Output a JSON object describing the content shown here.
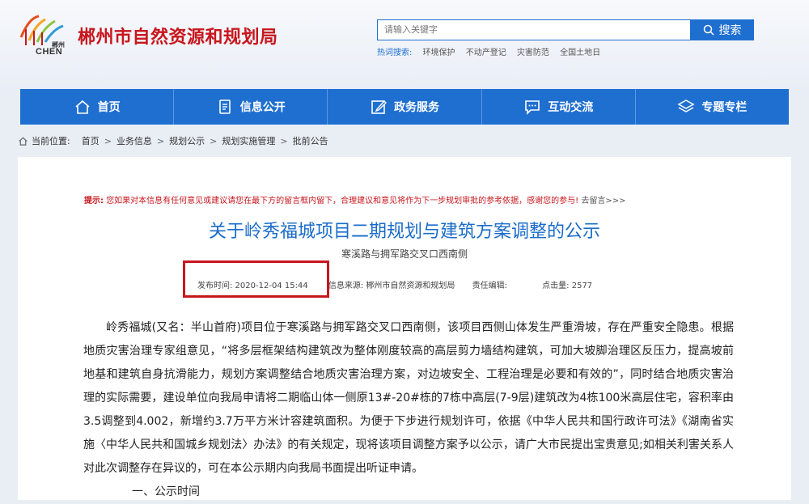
{
  "site": {
    "name": "郴州市自然资源和规划局",
    "logo_cn": "郴州",
    "logo_en": "CHEN"
  },
  "search": {
    "placeholder": "请输入关键字",
    "button_label": "搜索"
  },
  "hot_search": {
    "label": "热词搜索:",
    "items": [
      "环境保护",
      "不动产登记",
      "灾害防范",
      "全国土地日"
    ]
  },
  "nav": [
    {
      "label": "首页",
      "icon": "home-icon"
    },
    {
      "label": "信息公开",
      "icon": "document-icon"
    },
    {
      "label": "政务服务",
      "icon": "edit-icon"
    },
    {
      "label": "互动交流",
      "icon": "chat-icon"
    },
    {
      "label": "专题专栏",
      "icon": "layers-icon"
    }
  ],
  "breadcrumb": {
    "prefix": "当前位置:",
    "items": [
      "首页",
      "业务信息",
      "规划公示",
      "规划实施管理",
      "批前公告"
    ],
    "separator": ">"
  },
  "article": {
    "tip_label": "提示:",
    "tip_text": "您如果对本信息有任何意见或建议请您在最下方的留言框内留下，合理建议和意见将作为下一步规划审批的参考依据，感谢您的参与!",
    "tip_link": "去留言>>>",
    "title": "关于岭秀福城项目二期规划与建筑方案调整的公示",
    "subtitle": "寒溪路与拥军路交叉口西南侧",
    "meta": {
      "publish_time": "发布时间: 2020-12-04 15:44",
      "source": "信息来源: 郴州市自然资源和规划局",
      "editor": "责任编辑:",
      "hits": "点击量: 2577"
    },
    "body": "岭秀福城(又名：半山首府)项目位于寒溪路与拥军路交叉口西南侧，该项目西侧山体发生严重滑坡，存在严重安全隐患。根据地质灾害治理专家组意见，“将多层框架结构建筑改为整体刚度较高的高层剪力墙结构建筑，可加大坡脚治理区反压力，提高坡前地基和建筑自身抗滑能力，规划方案调整结合地质灾害治理方案，对边坡安全、工程治理是必要和有效的”，同时结合地质灾害治理的实际需要，建设单位向我局申请将二期临山体一侧原13#-20#栋的7栋中高层(7-9层)建筑改为4栋100米高层住宅，容积率由3.5调整到4.002，新增约3.7万平方米计容建筑面积。为便于下步进行规划许可，依据《中华人民共和国行政许可法》《湖南省实施〈中华人民共和国城乡规划法〉办法》的有关规定，现将该项目调整方案予以公示，请广大市民提出宝贵意见;如相关利害关系人对此次调整存在异议的，可在本公示期内向我局书面提出听证申请。",
    "section_head": "一、公示时间"
  },
  "colors": {
    "brand_red": "#c8161d",
    "nav_blue": "#1f6fd1",
    "title_blue": "#1a6cc9"
  }
}
